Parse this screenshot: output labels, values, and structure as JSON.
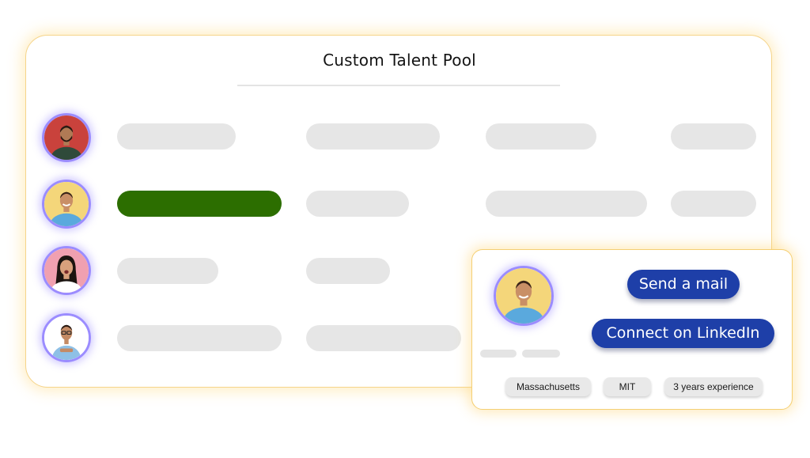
{
  "title": "Custom Talent Pool",
  "candidates": [
    {
      "name_icon": "avatar-man-beard-icon",
      "bg": "#c9423c",
      "shirt": "#2f4a3a",
      "skin": "#b07a55"
    },
    {
      "name_icon": "avatar-man-smiling-icon",
      "bg": "#f4d67a",
      "shirt": "#5aa9dd",
      "skin": "#c98f66"
    },
    {
      "name_icon": "avatar-woman-icon",
      "bg": "#f0a0b0",
      "shirt": "#ffffff",
      "skin": "#d8a07c"
    },
    {
      "name_icon": "avatar-man-glasses-icon",
      "bg": "#ffffff",
      "shirt": "#8ec0e6",
      "skin": "#c48a64"
    }
  ],
  "highlight_color": "#2c6e00",
  "profile_card": {
    "send_mail_label": "Send a mail",
    "connect_linkedin_label": "Connect on LinkedIn",
    "tags": [
      "Massachusetts",
      "MIT",
      "3 years experience"
    ],
    "button_color": "#1e3fa8"
  }
}
